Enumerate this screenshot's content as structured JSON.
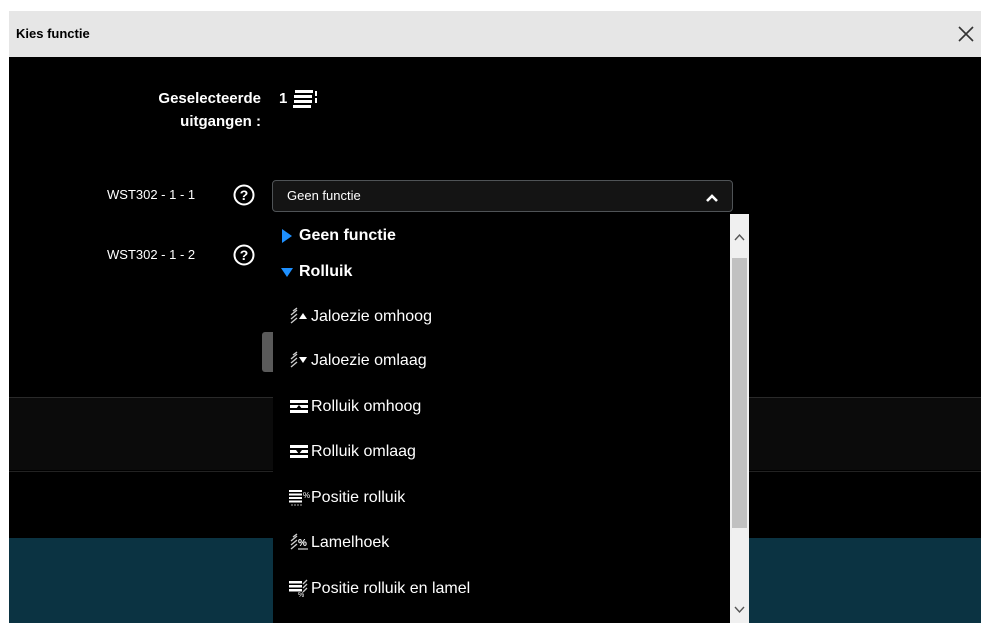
{
  "dialog": {
    "title": "Kies functie",
    "close_icon": "close-icon"
  },
  "selected": {
    "label": "Geselecteerde\nuitgangen :",
    "count": "1",
    "icon": "shutter-outputs-icon"
  },
  "outputs": [
    {
      "label": "WST302 - 1 - 1",
      "help_icon": "help-icon"
    },
    {
      "label": "WST302 - 1 - 2",
      "help_icon": "help-icon"
    }
  ],
  "function_select": {
    "value": "Geen functie",
    "chevron_icon": "chevron-up-icon"
  },
  "dropdown": {
    "groups": [
      {
        "label": "Geen functie",
        "expanded": false
      },
      {
        "label": "Rolluik",
        "expanded": true
      }
    ],
    "items": [
      {
        "label": "Jaloezie omhoog",
        "icon": "jalousie-up-icon"
      },
      {
        "label": "Jaloezie omlaag",
        "icon": "jalousie-down-icon"
      },
      {
        "label": "Rolluik omhoog",
        "icon": "shutter-up-icon"
      },
      {
        "label": "Rolluik omlaag",
        "icon": "shutter-down-icon"
      },
      {
        "label": "Positie rolluik",
        "icon": "shutter-position-icon"
      },
      {
        "label": "Lamelhoek",
        "icon": "slat-angle-icon"
      },
      {
        "label": "Positie rolluik en lamel",
        "icon": "shutter-slat-position-icon"
      }
    ]
  },
  "colors": {
    "dialog_bg": "#000000",
    "titlebar_bg": "#e6e6e6",
    "accent_blue": "#1e90ff",
    "bg_row_teal": "#0b3342"
  }
}
